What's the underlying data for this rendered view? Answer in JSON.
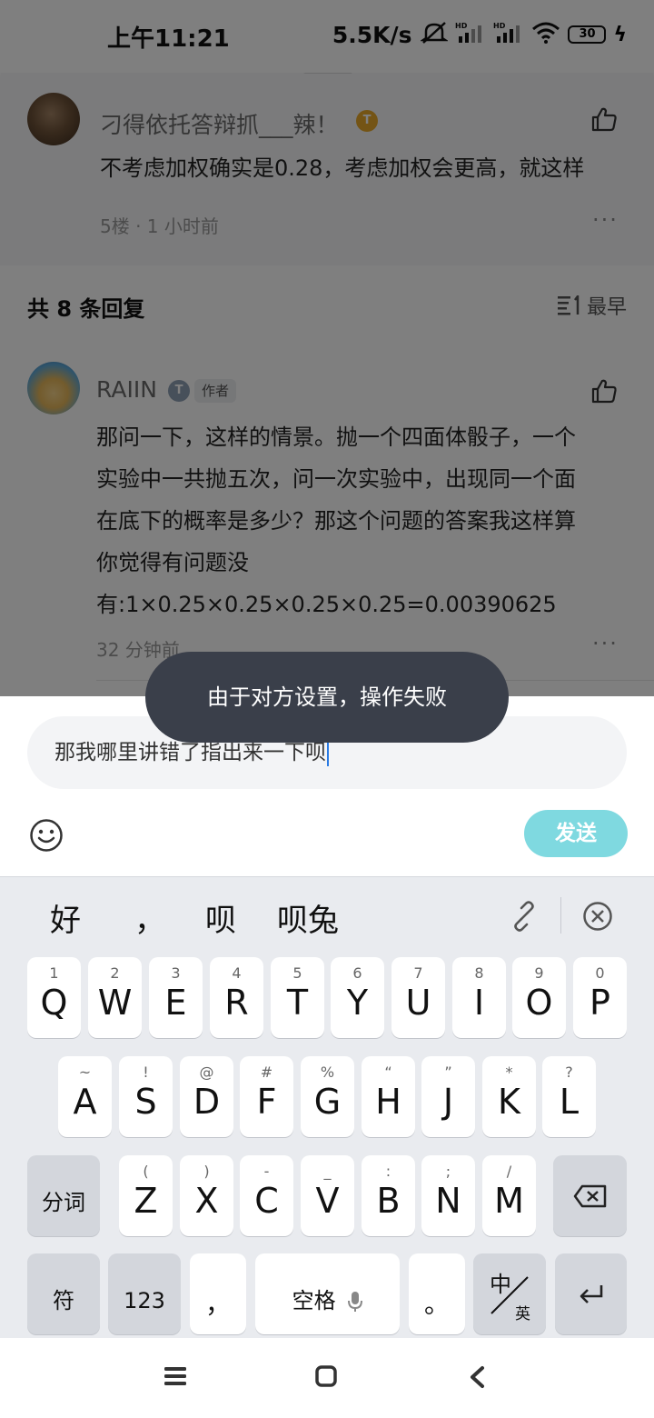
{
  "status_bar": {
    "time": "上午11:21",
    "net_speed": "5.5K/s",
    "battery": "30"
  },
  "root_comment": {
    "username": "刁得依托答辩抓___辣！",
    "level_badge": "T",
    "text": "不考虑加权确实是0.28，考虑加权会更高，就这样",
    "meta": "5楼 · 1 小时前",
    "more_label": "···"
  },
  "replies_header": {
    "count_label": "共 8 条回复",
    "sort_label": "最早"
  },
  "reply": {
    "username": "RAIIN",
    "level_badge": "T",
    "author_tag": "作者",
    "lines": [
      "那问一下，这样的情景。抛一个四面体骰子，一个",
      "实验中一共抛五次，问一次实验中，出现同一个面",
      "在底下的概率是多少？那这个问题的答案我这样算",
      "你觉得有问题没",
      "有:1×0.25×0.25×0.25×0.25=0.00390625"
    ],
    "meta": "32 分钟前",
    "more_label": "···"
  },
  "toast": {
    "text": "由于对方设置，操作失败"
  },
  "composer": {
    "input_value": "那我哪里讲错了指出来一下呗",
    "send_label": "发送",
    "send_color": "#7fd9e0"
  },
  "keyboard": {
    "candidates": [
      "好",
      "，",
      "呗",
      "呗兔"
    ],
    "row1": [
      {
        "main": "Q",
        "sub": "1"
      },
      {
        "main": "W",
        "sub": "2"
      },
      {
        "main": "E",
        "sub": "3"
      },
      {
        "main": "R",
        "sub": "4"
      },
      {
        "main": "T",
        "sub": "5"
      },
      {
        "main": "Y",
        "sub": "6"
      },
      {
        "main": "U",
        "sub": "7"
      },
      {
        "main": "I",
        "sub": "8"
      },
      {
        "main": "O",
        "sub": "9"
      },
      {
        "main": "P",
        "sub": "0"
      }
    ],
    "row2": [
      {
        "main": "A",
        "sub": "~"
      },
      {
        "main": "S",
        "sub": "!"
      },
      {
        "main": "D",
        "sub": "@"
      },
      {
        "main": "F",
        "sub": "#"
      },
      {
        "main": "G",
        "sub": "%"
      },
      {
        "main": "H",
        "sub": "“"
      },
      {
        "main": "J",
        "sub": "”"
      },
      {
        "main": "K",
        "sub": "*"
      },
      {
        "main": "L",
        "sub": "?"
      }
    ],
    "row3": [
      {
        "main": "Z",
        "sub": "("
      },
      {
        "main": "X",
        "sub": ")"
      },
      {
        "main": "C",
        "sub": "-"
      },
      {
        "main": "V",
        "sub": "_"
      },
      {
        "main": "B",
        "sub": ":"
      },
      {
        "main": "N",
        "sub": ";"
      },
      {
        "main": "M",
        "sub": "/"
      }
    ],
    "segment_label": "分词",
    "symbol_label": "符",
    "num_label": "123",
    "comma_label": "，",
    "space_label": "空格",
    "period_label": "。",
    "lang_top": "中",
    "lang_bottom": "英"
  }
}
